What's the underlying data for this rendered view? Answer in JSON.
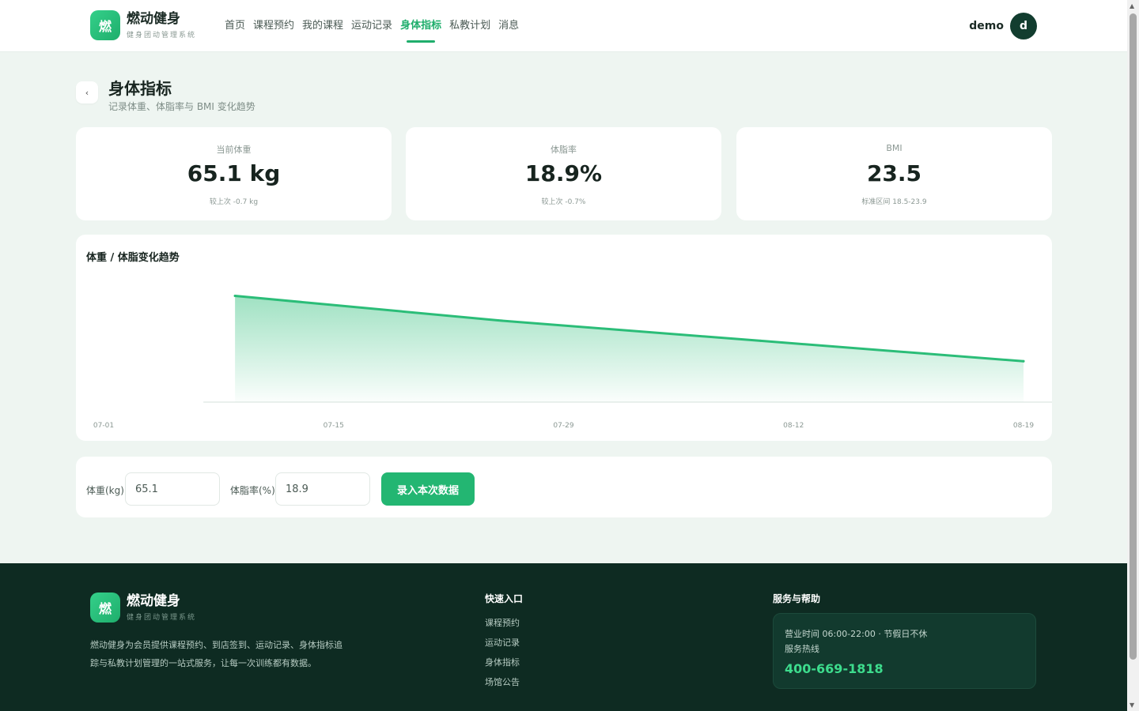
{
  "brand": {
    "logo_char": "燃",
    "name": "燃动健身",
    "subtitle": "健身团动管理系统"
  },
  "nav": {
    "items": [
      {
        "label": "首页"
      },
      {
        "label": "课程预约"
      },
      {
        "label": "我的课程"
      },
      {
        "label": "运动记录"
      },
      {
        "label": "身体指标",
        "active": true
      },
      {
        "label": "私教计划"
      },
      {
        "label": "消息"
      }
    ]
  },
  "user": {
    "name": "demo",
    "avatar_char": "d"
  },
  "page": {
    "back_glyph": "‹",
    "title": "身体指标",
    "subtitle": "记录体重、体脂率与 BMI 变化趋势"
  },
  "stats": [
    {
      "label": "当前体重",
      "value": "65.1 kg",
      "note": "较上次 -0.7 kg"
    },
    {
      "label": "体脂率",
      "value": "18.9%",
      "note": "较上次 -0.7%"
    },
    {
      "label": "BMI",
      "value": "23.5",
      "note": "标准区间 18.5-23.9"
    }
  ],
  "chart_data": {
    "type": "area",
    "title": "体重 / 体脂变化趋势",
    "x_ticks": [
      "07-01",
      "07-15",
      "07-29",
      "08-12",
      "08-19"
    ],
    "series": [
      {
        "points": [
          {
            "x": "07-08",
            "y": 67.2
          },
          {
            "x": "07-22",
            "y": 66.6
          },
          {
            "x": "08-05",
            "y": 66.1
          },
          {
            "x": "08-19",
            "y": 65.6
          }
        ]
      }
    ],
    "ylim": [
      64.6,
      67.5
    ],
    "grid": false,
    "color": "#2bbd78"
  },
  "form": {
    "weight_label": "体重(kg)",
    "weight_value": "65.1",
    "fat_label": "体脂率(%)",
    "fat_value": "18.9",
    "submit_label": "录入本次数据"
  },
  "footer": {
    "brand_name": "燃动健身",
    "brand_sub": "健身团动管理系统",
    "description": "燃动健身为会员提供课程预约、到店签到、运动记录、身体指标追踪与私教计划管理的一站式服务，让每一次训练都有数据。",
    "quick_title": "快速入口",
    "quick_links": [
      "课程预约",
      "运动记录",
      "身体指标",
      "场馆公告"
    ],
    "help_title": "服务与帮助",
    "hours": "营业时间 06:00-22:00 · 节假日不休",
    "hotline_label": "服务热线",
    "hotline": "400-669-1818"
  },
  "colors": {
    "accent": "#1fae6c",
    "footer_bg": "#0e2b22",
    "hotline": "#3ddc8d"
  }
}
